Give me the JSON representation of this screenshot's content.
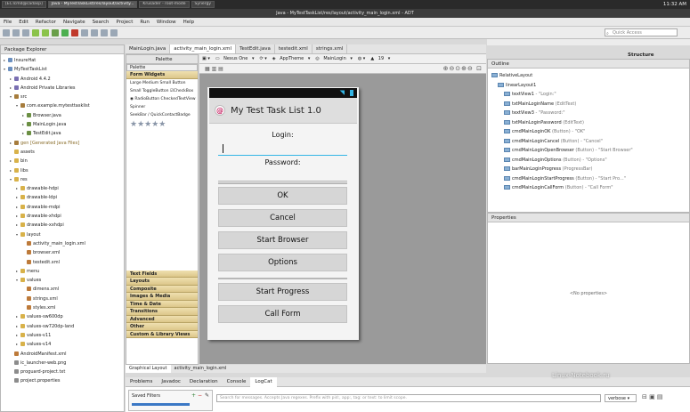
{
  "os_taskbar": {
    "windows": [
      {
        "label": "[ECTcmd@cadasp]",
        "active": false
      },
      {
        "label": "Java - MyTestTaskList/res/layout/activity...",
        "active": true
      },
      {
        "label": "Krusader - root-mode",
        "active": false
      },
      {
        "label": "Synergy",
        "active": false
      }
    ],
    "clock": "11:32 AM"
  },
  "window_title": "Java - MyTestTaskList/res/layout/activity_main_login.xml - ADT",
  "menu": [
    "File",
    "Edit",
    "Refactor",
    "Navigate",
    "Search",
    "Project",
    "Run",
    "Window",
    "Help"
  ],
  "quick_access": {
    "placeholder": "Quick Access"
  },
  "perspective": "Structure",
  "package_explorer": {
    "title": "Package Explorer",
    "items": [
      {
        "label": "InsureHat",
        "level": 0,
        "icon": "proj",
        "arrow": "▸"
      },
      {
        "label": "MyTestTaskList",
        "level": 0,
        "icon": "proj",
        "arrow": "▾"
      },
      {
        "label": "Android 4.4.2",
        "level": 1,
        "icon": "lib",
        "arrow": "▸"
      },
      {
        "label": "Android Private Libraries",
        "level": 1,
        "icon": "lib",
        "arrow": "▸"
      },
      {
        "label": "src",
        "level": 1,
        "icon": "pkg",
        "arrow": "▾"
      },
      {
        "label": "com.example.mytesttasklist",
        "level": 2,
        "icon": "pkg",
        "arrow": "▾"
      },
      {
        "label": "Browser.java",
        "level": 3,
        "icon": "java",
        "arrow": "▸"
      },
      {
        "label": "MainLogin.java",
        "level": 3,
        "icon": "java",
        "arrow": "▸"
      },
      {
        "label": "TestEdit.java",
        "level": 3,
        "icon": "java",
        "arrow": "▸"
      },
      {
        "label": "gen [Generated Java Files]",
        "level": 1,
        "icon": "pkg",
        "arrow": "▸"
      },
      {
        "label": "assets",
        "level": 1,
        "icon": "folder",
        "arrow": ""
      },
      {
        "label": "bin",
        "level": 1,
        "icon": "folder",
        "arrow": "▸"
      },
      {
        "label": "libs",
        "level": 1,
        "icon": "folder",
        "arrow": "▸"
      },
      {
        "label": "res",
        "level": 1,
        "icon": "folder",
        "arrow": "▾"
      },
      {
        "label": "drawable-hdpi",
        "level": 2,
        "icon": "folder",
        "arrow": "▸"
      },
      {
        "label": "drawable-ldpi",
        "level": 2,
        "icon": "folder",
        "arrow": "▸"
      },
      {
        "label": "drawable-mdpi",
        "level": 2,
        "icon": "folder",
        "arrow": "▸"
      },
      {
        "label": "drawable-xhdpi",
        "level": 2,
        "icon": "folder",
        "arrow": "▸"
      },
      {
        "label": "drawable-xxhdpi",
        "level": 2,
        "icon": "folder",
        "arrow": "▸"
      },
      {
        "label": "layout",
        "level": 2,
        "icon": "folder",
        "arrow": "▾"
      },
      {
        "label": "activity_main_login.xml",
        "level": 3,
        "icon": "xml",
        "arrow": ""
      },
      {
        "label": "browser.xml",
        "level": 3,
        "icon": "xml",
        "arrow": ""
      },
      {
        "label": "testedit.xml",
        "level": 3,
        "icon": "xml",
        "arrow": ""
      },
      {
        "label": "menu",
        "level": 2,
        "icon": "folder",
        "arrow": "▸"
      },
      {
        "label": "values",
        "level": 2,
        "icon": "folder",
        "arrow": "▾"
      },
      {
        "label": "dimens.xml",
        "level": 3,
        "icon": "xml",
        "arrow": ""
      },
      {
        "label": "strings.xml",
        "level": 3,
        "icon": "xml",
        "arrow": ""
      },
      {
        "label": "styles.xml",
        "level": 3,
        "icon": "xml",
        "arrow": ""
      },
      {
        "label": "values-sw600dp",
        "level": 2,
        "icon": "folder",
        "arrow": "▸"
      },
      {
        "label": "values-sw720dp-land",
        "level": 2,
        "icon": "folder",
        "arrow": "▸"
      },
      {
        "label": "values-v11",
        "level": 2,
        "icon": "folder",
        "arrow": "▸"
      },
      {
        "label": "values-v14",
        "level": 2,
        "icon": "folder",
        "arrow": "▸"
      },
      {
        "label": "AndroidManifest.xml",
        "level": 1,
        "icon": "xml",
        "arrow": ""
      },
      {
        "label": "ic_launcher-web.png",
        "level": 1,
        "icon": "file",
        "arrow": ""
      },
      {
        "label": "proguard-project.txt",
        "level": 1,
        "icon": "file",
        "arrow": ""
      },
      {
        "label": "project.properties",
        "level": 1,
        "icon": "file",
        "arrow": ""
      }
    ]
  },
  "editor_tabs": [
    {
      "label": "MainLogin.java",
      "active": false
    },
    {
      "label": "activity_main_login.xml",
      "active": true
    },
    {
      "label": "TestEdit.java",
      "active": false
    },
    {
      "label": "testedit.xml",
      "active": false
    },
    {
      "label": "strings.xml",
      "active": false
    }
  ],
  "palette": {
    "title": "Palette",
    "dropdown": "Palette",
    "top_section": "Form Widgets",
    "widget_rows": [
      "Large Medium Small Button",
      "Small ToggleButton ☑CheckBox",
      "◉ RadioButton CheckedTextView",
      "Spinner",
      "SeekBar / QuickContactBadge"
    ],
    "sections": [
      "Text Fields",
      "Layouts",
      "Composite",
      "Images & Media",
      "Time & Date",
      "Transitions",
      "Advanced",
      "Other",
      "Custom & Library Views"
    ]
  },
  "canvas_toolbar": {
    "device": "Nexus One",
    "theme": "AppTheme",
    "activity": "MainLogin",
    "api": "19"
  },
  "app": {
    "title": "My Test Task List 1.0",
    "login_label": "Login:",
    "password_label": "Password:",
    "buttons": [
      "OK",
      "Cancel",
      "Start Browser",
      "Options",
      "Start Progress",
      "Call Form"
    ]
  },
  "design_tabs": [
    {
      "label": "Graphical Layout",
      "active": true
    },
    {
      "label": "activity_main_login.xml",
      "active": false
    }
  ],
  "outline": {
    "title": "Outline",
    "items": [
      {
        "label": "RelativeLayout",
        "extra": "",
        "level": 0
      },
      {
        "label": "linearLayout1",
        "extra": "",
        "level": 1
      },
      {
        "label": "textView1",
        "extra": " - \"Login:\"",
        "level": 2
      },
      {
        "label": "txtMainLoginName",
        "extra": " (EditText)",
        "level": 2
      },
      {
        "label": "textView3",
        "extra": " - \"Password:\"",
        "level": 2
      },
      {
        "label": "txtMainLoginPassword",
        "extra": " (EditText)",
        "level": 2
      },
      {
        "label": "cmdMainLoginOK",
        "extra": " (Button) - \"OK\"",
        "level": 2
      },
      {
        "label": "cmdMainLoginCancel",
        "extra": " (Button) - \"Cancel\"",
        "level": 2
      },
      {
        "label": "cmdMainLoginOpenBrowser",
        "extra": " (Button) - \"Start Browser\"",
        "level": 2
      },
      {
        "label": "cmdMainLoginOptions",
        "extra": " (Button) - \"Options\"",
        "level": 2
      },
      {
        "label": "barMainLoginProgress",
        "extra": " (ProgressBar)",
        "level": 2
      },
      {
        "label": "cmdMainLoginStartProgress",
        "extra": " (Button) - \"Start Pro...\"",
        "level": 2
      },
      {
        "label": "cmdMainLoginCallForm",
        "extra": " (Button) - \"Call Form\"",
        "level": 2
      }
    ]
  },
  "properties": {
    "title": "Properties",
    "empty_text": "<No properties>"
  },
  "bottom_tabs": [
    {
      "label": "Problems",
      "active": false
    },
    {
      "label": "Javadoc",
      "active": false
    },
    {
      "label": "Declaration",
      "active": false
    },
    {
      "label": "Console",
      "active": false
    },
    {
      "label": "LogCat",
      "active": true
    }
  ],
  "logcat": {
    "saved_filters": "Saved Filters",
    "search_placeholder": "Search for messages. Accepts Java regexes. Prefix with pid:, app:, tag: or text: to limit scope.",
    "level": "verbose"
  },
  "watermark": "Linux-Notebook.ru"
}
